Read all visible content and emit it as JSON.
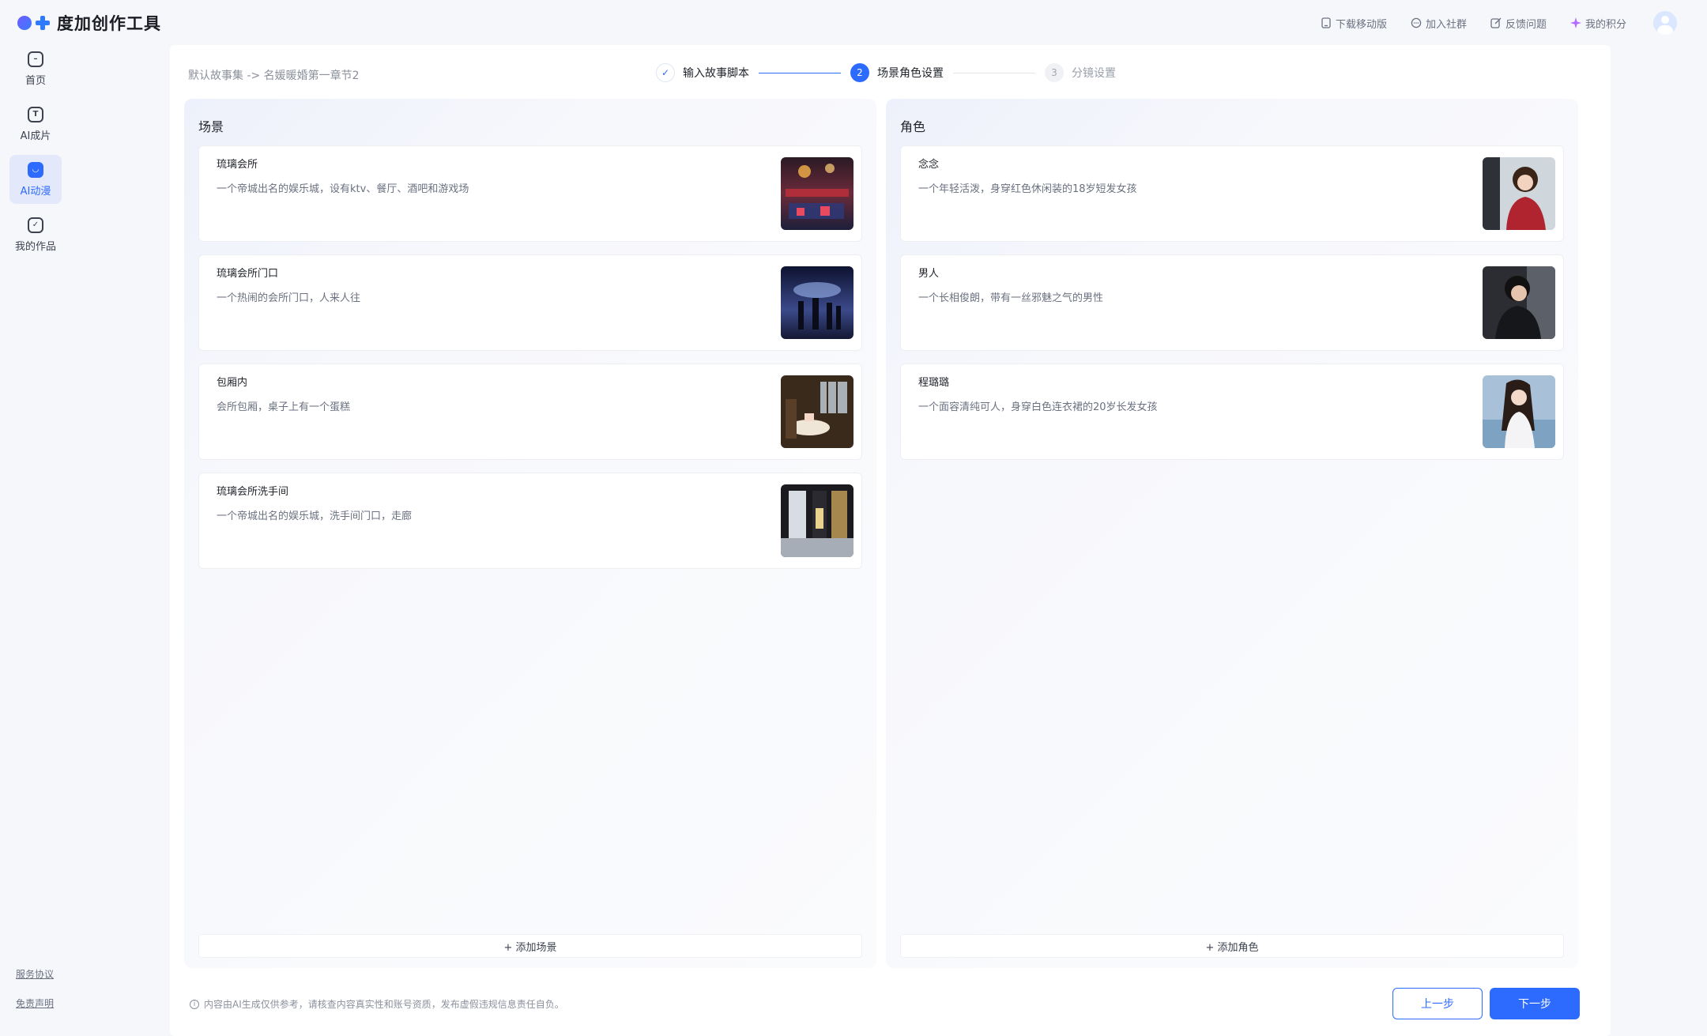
{
  "app": {
    "logo_text": "度加创作工具"
  },
  "topbar": {
    "actions": [
      {
        "label": "下载移动版",
        "icon": "mobile-icon"
      },
      {
        "label": "加入社群",
        "icon": "chat-icon"
      },
      {
        "label": "反馈问题",
        "icon": "edit-icon"
      },
      {
        "label": "我的积分",
        "icon": "sparkle-icon"
      }
    ]
  },
  "sidebar": {
    "items": [
      {
        "label": "首页",
        "icon": "home-icon"
      },
      {
        "label": "AI成片",
        "icon": "text-t-icon"
      },
      {
        "label": "AI动漫",
        "icon": "anime-icon",
        "active": true
      },
      {
        "label": "我的作品",
        "icon": "check-box-icon"
      }
    ],
    "links": [
      "服务协议",
      "免责声明"
    ]
  },
  "breadcrumb": "默认故事集 -> 名媛暖婚第一章节2",
  "steps": [
    {
      "num": "✓",
      "label": "输入故事脚本",
      "state": "done"
    },
    {
      "num": "2",
      "label": "场景角色设置",
      "state": "active"
    },
    {
      "num": "3",
      "label": "分镜设置",
      "state": "todo"
    }
  ],
  "scenes": {
    "title": "场景",
    "items": [
      {
        "name": "琉璃会所",
        "desc": "一个帝城出名的娱乐城，设有ktv、餐厅、酒吧和游戏场"
      },
      {
        "name": "琉璃会所门口",
        "desc": "一个热闹的会所门口，人来人往"
      },
      {
        "name": "包厢内",
        "desc": "会所包厢，桌子上有一个蛋糕"
      },
      {
        "name": "琉璃会所洗手间",
        "desc": "一个帝城出名的娱乐城，洗手间门口，走廊"
      }
    ],
    "add_label": "+ 添加场景"
  },
  "roles": {
    "title": "角色",
    "items": [
      {
        "name": "念念",
        "desc": "一个年轻活泼，身穿红色休闲装的18岁短发女孩"
      },
      {
        "name": "男人",
        "desc": "一个长相俊朗，带有一丝邪魅之气的男性"
      },
      {
        "name": "程璐璐",
        "desc": "一个面容清纯可人，身穿白色连衣裙的20岁长发女孩"
      }
    ],
    "add_label": "+ 添加角色"
  },
  "footer": {
    "note": "内容由AI生成仅供参考，请核查内容真实性和账号资质，发布虚假违规信息责任自负。",
    "prev_label": "上一步",
    "next_label": "下一步"
  },
  "colors": {
    "accent": "#2d6bff"
  }
}
